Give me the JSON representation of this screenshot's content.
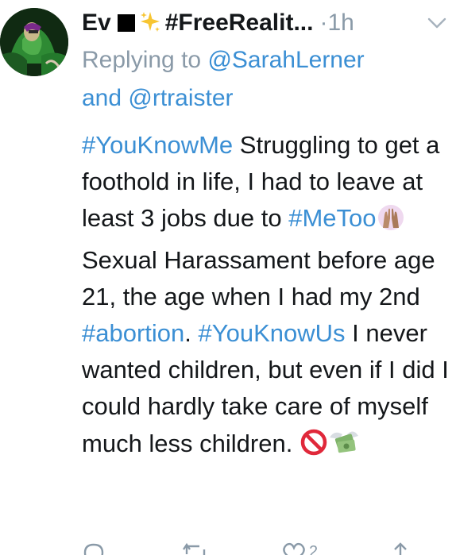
{
  "tweet": {
    "display_name_prefix": "Ev",
    "display_name_suffix": "#FreeRealit...",
    "timestamp": "1h",
    "separator": "·",
    "replying_prefix": "Replying to ",
    "replying_user1": "@SarahLerner",
    "replying_and": "and ",
    "replying_user2": "@rtraister",
    "body": {
      "hashtag1": "#YouKnowMe",
      "text1": " Struggling to get a foothold in life, I had to leave at least 3 jobs due to ",
      "hashtag2": "#MeToo",
      "text2": " Sexual Harassament before age 21, the age when I had my 2nd ",
      "hashtag3": "#abortion",
      "text3": ". ",
      "hashtag4": "#YouKnowUs",
      "text4": " I never wanted children, but even if I did I could hardly take care of myself much less children. "
    },
    "actions": {
      "like_count": "2"
    },
    "icons": {
      "sparkles": "sparkles-emoji",
      "raised_hands": "raising-hands-emoji",
      "prohibited": "prohibited-emoji",
      "money_wings": "money-with-wings-emoji",
      "chevron": "chevron-down-icon"
    },
    "colors": {
      "link": "#3b8fd4",
      "meta": "#8a9aa8",
      "text": "#14171a"
    }
  }
}
